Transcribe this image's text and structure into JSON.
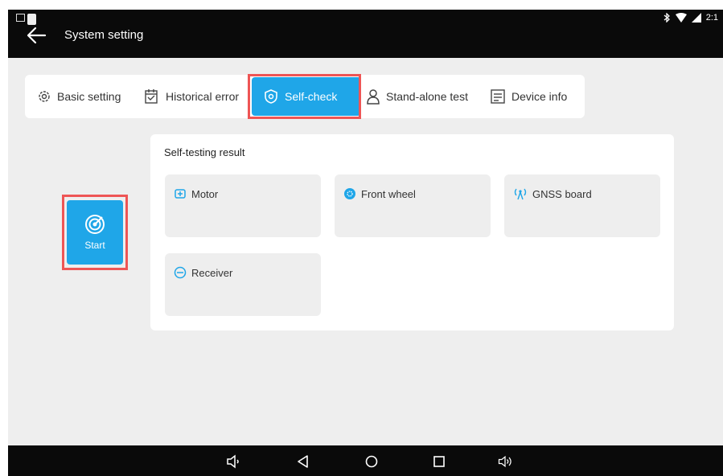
{
  "topbar": {
    "title": "System setting",
    "time": "2:1"
  },
  "tabs": [
    {
      "label": "Basic setting",
      "icon": "gear-icon"
    },
    {
      "label": "Historical error",
      "icon": "calendar-icon"
    },
    {
      "label": "Self-check",
      "icon": "shield-icon",
      "active": true
    },
    {
      "label": "Stand-alone test",
      "icon": "person-icon"
    },
    {
      "label": "Device info",
      "icon": "device-info-icon"
    }
  ],
  "start": {
    "label": "Start"
  },
  "results": {
    "title": "Self-testing result",
    "items": [
      {
        "label": "Motor",
        "icon": "motor-icon"
      },
      {
        "label": "Front wheel",
        "icon": "wheel-icon"
      },
      {
        "label": "GNSS board",
        "icon": "antenna-icon"
      },
      {
        "label": "Receiver",
        "icon": "receiver-icon"
      }
    ]
  },
  "colors": {
    "accent": "#1fa6e8",
    "highlight": "#e55555",
    "bar": "#0a0a0a"
  }
}
